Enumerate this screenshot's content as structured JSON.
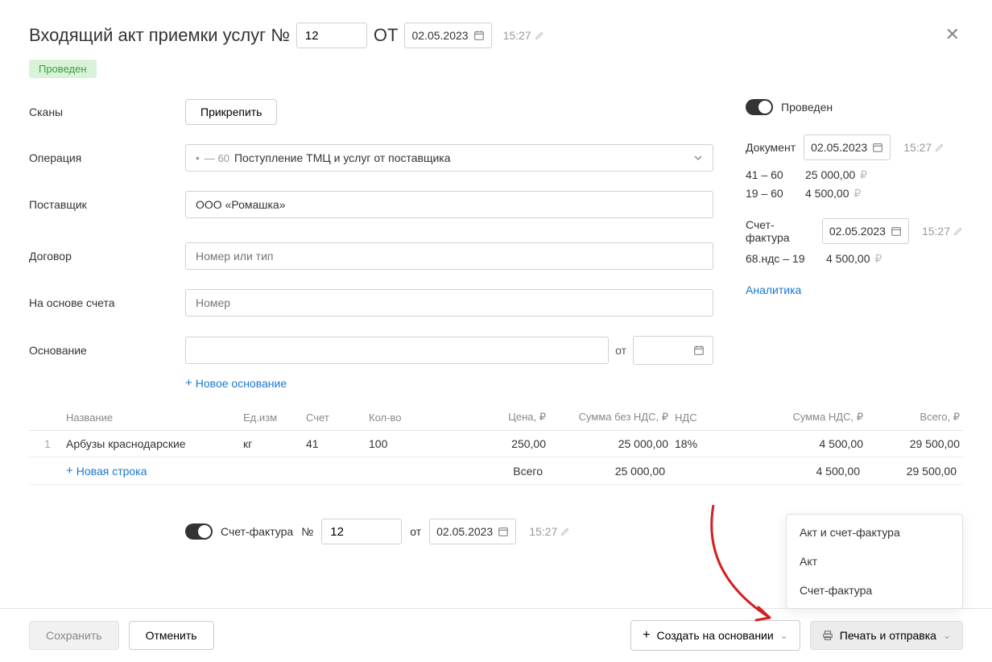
{
  "header": {
    "title_prefix": "Входящий акт приемки услуг №",
    "number": "12",
    "from_label": "ОТ",
    "date": "02.05.2023",
    "time": "15:27"
  },
  "status_badge": "Проведен",
  "form": {
    "scans": {
      "label": "Сканы",
      "attach_btn": "Прикрепить"
    },
    "operation": {
      "label": "Операция",
      "code": "— 60",
      "text": "Поступление ТМЦ и услуг от поставщика"
    },
    "supplier": {
      "label": "Поставщик",
      "value": "ООО «Ромашка»"
    },
    "contract": {
      "label": "Договор",
      "placeholder": "Номер или тип"
    },
    "based_on_invoice": {
      "label": "На основе счета",
      "placeholder": "Номер"
    },
    "basis": {
      "label": "Основание",
      "from": "от",
      "new_basis": "Новое основание"
    }
  },
  "right": {
    "posted_toggle_label": "Проведен",
    "document": {
      "label": "Документ",
      "date": "02.05.2023",
      "time": "15:27",
      "entries": [
        {
          "codes": "41 – 60",
          "amount": "25 000,00"
        },
        {
          "codes": "19 – 60",
          "amount": "4 500,00"
        }
      ]
    },
    "invoice": {
      "label": "Счет-фактура",
      "date": "02.05.2023",
      "time": "15:27",
      "entries": [
        {
          "codes": "68.ндс – 19",
          "amount": "4 500,00"
        }
      ]
    },
    "analytics_link": "Аналитика"
  },
  "table": {
    "headers": {
      "name": "Название",
      "unit": "Ед.изм",
      "account": "Счет",
      "qty": "Кол-во",
      "price": "Цена, ₽",
      "sum_no_vat": "Сумма без НДС, ₽",
      "vat": "НДС",
      "sum_vat": "Сумма НДС, ₽",
      "total": "Всего, ₽"
    },
    "rows": [
      {
        "idx": "1",
        "name": "Арбузы краснодарские",
        "unit": "кг",
        "account": "41",
        "qty": "100",
        "price": "250,00",
        "sum_no_vat": "25 000,00",
        "vat": "18%",
        "sum_vat": "4 500,00",
        "total": "29 500,00"
      }
    ],
    "add_row": "Новая строка",
    "totals": {
      "label": "Всего",
      "sum_no_vat": "25 000,00",
      "sum_vat": "4 500,00",
      "total": "29 500,00"
    }
  },
  "invoice_section": {
    "label": "Счет-фактура",
    "num_label": "№",
    "num": "12",
    "from": "от",
    "date": "02.05.2023",
    "time": "15:27"
  },
  "footer": {
    "save": "Сохранить",
    "cancel": "Отменить",
    "create_based": "Создать на основании",
    "print_send": "Печать и отправка"
  },
  "print_menu": {
    "items": [
      "Акт и счет-фактура",
      "Акт",
      "Счет-фактура"
    ]
  }
}
